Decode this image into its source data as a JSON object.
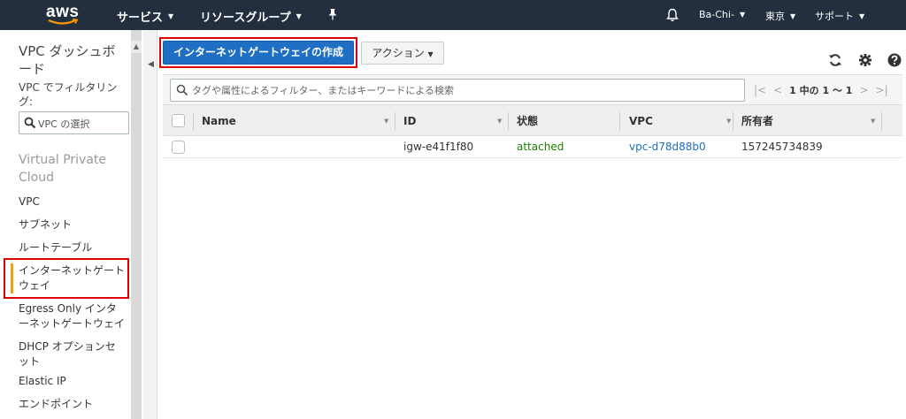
{
  "topnav": {
    "logo_text": "aws",
    "services": "サービス",
    "resource_groups": "リソースグループ",
    "user": "Ba-Chi-",
    "region": "東京",
    "support": "サポート"
  },
  "sidebar": {
    "title": "VPC ダッシュボード",
    "filter_label": "VPC でフィルタリング:",
    "vpc_select": "VPC の選択",
    "section_title": "Virtual Private Cloud",
    "items": [
      {
        "label": "VPC"
      },
      {
        "label": "サブネット"
      },
      {
        "label": "ルートテーブル"
      },
      {
        "label": "インターネットゲートウェイ"
      },
      {
        "label": "Egress Only インターネットゲートウェイ"
      },
      {
        "label": "DHCP オプションセット"
      },
      {
        "label": "Elastic IP"
      },
      {
        "label": "エンドポイント"
      }
    ]
  },
  "toolbar": {
    "create_label": "インターネットゲートウェイの作成",
    "actions_label": "アクション"
  },
  "search": {
    "placeholder": "タグや属性によるフィルター、またはキーワードによる検索"
  },
  "pager": {
    "text": "1 中の 1 ～ 1"
  },
  "table": {
    "columns": [
      "Name",
      "ID",
      "状態",
      "VPC",
      "所有者"
    ],
    "rows": [
      {
        "name": "",
        "id": "igw-e41f1f80",
        "state": "attached",
        "vpc": "vpc-d78d88b0",
        "owner": "157245734839"
      }
    ]
  },
  "colors": {
    "nav_bg": "#232f3e",
    "primary": "#1f6fc5",
    "status_green": "#1d8102",
    "highlight_red": "#dd0000",
    "active_bar": "#e8a317"
  }
}
